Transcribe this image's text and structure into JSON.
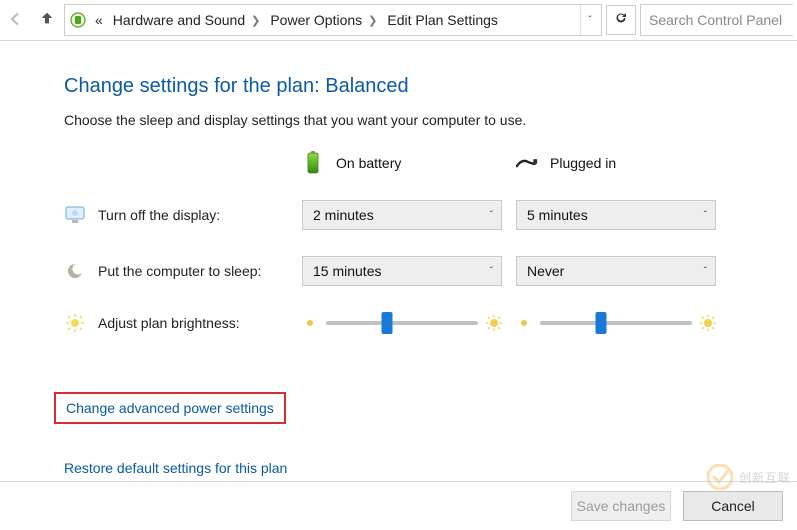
{
  "header": {
    "breadcrumbs": [
      "Hardware and Sound",
      "Power Options",
      "Edit Plan Settings"
    ],
    "back_ellipsis": "«",
    "search_placeholder": "Search Control Panel"
  },
  "title": "Change settings for the plan: Balanced",
  "subtitle": "Choose the sleep and display settings that you want your computer to use.",
  "columns": {
    "battery": "On battery",
    "plugged": "Plugged in"
  },
  "rows": {
    "display": {
      "label": "Turn off the display:",
      "battery": "2 minutes",
      "plugged": "5 minutes"
    },
    "sleep": {
      "label": "Put the computer to sleep:",
      "battery": "15 minutes",
      "plugged": "Never"
    },
    "brightness": {
      "label": "Adjust plan brightness:",
      "battery_pct": 40,
      "plugged_pct": 40
    }
  },
  "links": {
    "advanced": "Change advanced power settings",
    "restore": "Restore default settings for this plan"
  },
  "footer": {
    "save": "Save changes",
    "cancel": "Cancel"
  },
  "watermark": "创新互联"
}
